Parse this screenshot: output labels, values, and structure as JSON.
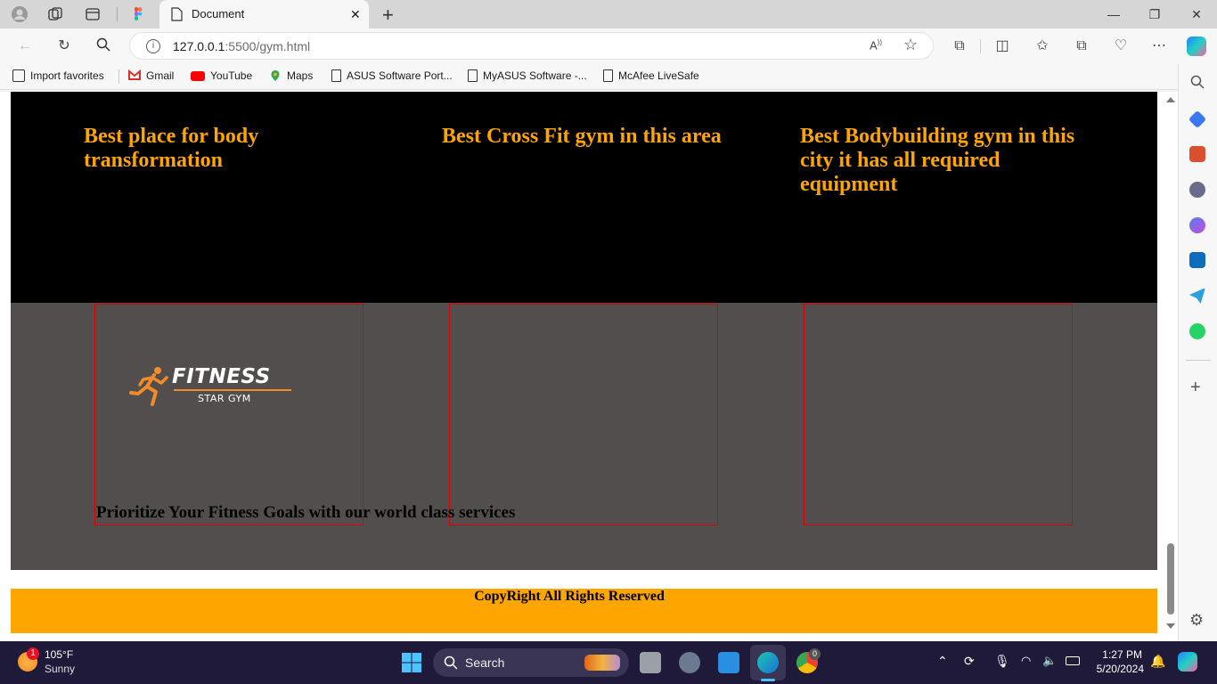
{
  "browser": {
    "tab_title": "Document",
    "tab_close": "✕",
    "new_tab": "+",
    "url_host": "127.0.0.1",
    "url_path": ":5500/gym.html",
    "window_controls": {
      "minimize": "—",
      "restore": "❐",
      "close": "✕"
    }
  },
  "favorites": [
    {
      "label": "Import favorites",
      "icon": "import-icon"
    },
    {
      "label": "Gmail",
      "icon": "gmail-icon"
    },
    {
      "label": "YouTube",
      "icon": "youtube-icon"
    },
    {
      "label": "Maps",
      "icon": "maps-icon"
    },
    {
      "label": "ASUS Software Port...",
      "icon": "page-icon"
    },
    {
      "label": "MyASUS Software -...",
      "icon": "page-icon"
    },
    {
      "label": "McAfee LiveSafe",
      "icon": "page-icon"
    }
  ],
  "page": {
    "features": [
      "Best place for body transformation",
      "Best Cross Fit gym in this area",
      "Best Bodybuilding gym in this city it has all required equipment"
    ],
    "logo": {
      "title": "FITNESS",
      "subtitle": "STAR GYM"
    },
    "tagline": "Prioritize Your Fitness Goals with our world class services",
    "footer": "CopyRight All Rights Reserved"
  },
  "colors": {
    "accent": "#ffa500",
    "grey_band": "#524e4e",
    "card_border": "#e00000"
  },
  "taskbar": {
    "weather_temp": "105°F",
    "weather_desc": "Sunny",
    "weather_badge": "1",
    "search_label": "Search",
    "chrome_badge": "0",
    "time": "1:27 PM",
    "date": "5/20/2024"
  }
}
